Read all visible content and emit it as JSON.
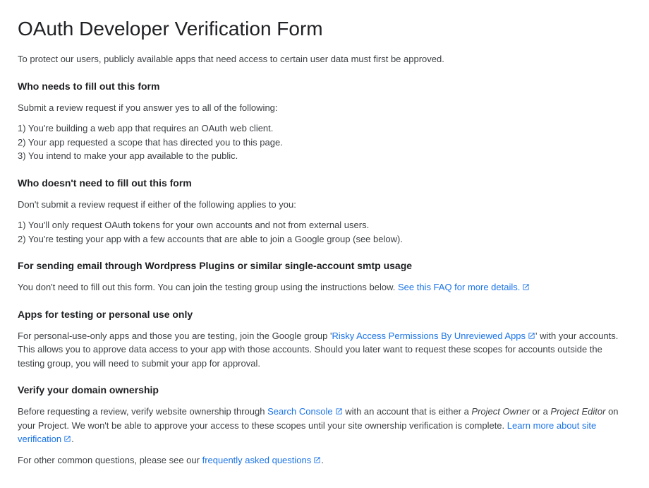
{
  "title": "OAuth Developer Verification Form",
  "intro": "To protect our users, publicly available apps that need access to certain user data must first be approved.",
  "section_who_needs": {
    "heading": "Who needs to fill out this form",
    "intro": "Submit a review request if you answer yes to all of the following:",
    "items": [
      "1) You're building a web app that requires an OAuth web client.",
      "2) Your app requested a scope that has directed you to this page.",
      "3) You intend to make your app available to the public."
    ]
  },
  "section_who_doesnt": {
    "heading": "Who doesn't need to fill out this form",
    "intro": "Don't submit a review request if either of the following applies to you:",
    "items": [
      "1) You'll only request OAuth tokens for your own accounts and not from external users.",
      "2) You're testing your app with a few accounts that are able to join a Google group (see below)."
    ]
  },
  "section_wordpress": {
    "heading": "For sending email through Wordpress Plugins or similar single-account smtp usage",
    "text": "You don't need to fill out this form. You can join the testing group using the instructions below. ",
    "link": "See this FAQ for more details."
  },
  "section_testing": {
    "heading": "Apps for testing or personal use only",
    "text_before": "For personal-use-only apps and those you are testing, join the Google group '",
    "link": "Risky Access Permissions By Unreviewed Apps",
    "text_after": "' with your accounts. This allows you to approve data access to your app with those accounts. Should you later want to request these scopes for accounts outside the testing group, you will need to submit your app for approval."
  },
  "section_verify": {
    "heading": "Verify your domain ownership",
    "text_before": "Before requesting a review, verify website ownership through ",
    "link1": "Search Console",
    "text_mid1": " with an account that is either a ",
    "em1": "Project Owner",
    "text_mid2": " or a ",
    "em2": "Project Editor",
    "text_mid3": " on your Project. We won't be able to approve your access to these scopes until your site ownership verification is complete. ",
    "link2": "Learn more about site verification",
    "text_after": "."
  },
  "footer": {
    "text_before": "For other common questions, please see our ",
    "link": "frequently asked questions",
    "text_after": "."
  }
}
